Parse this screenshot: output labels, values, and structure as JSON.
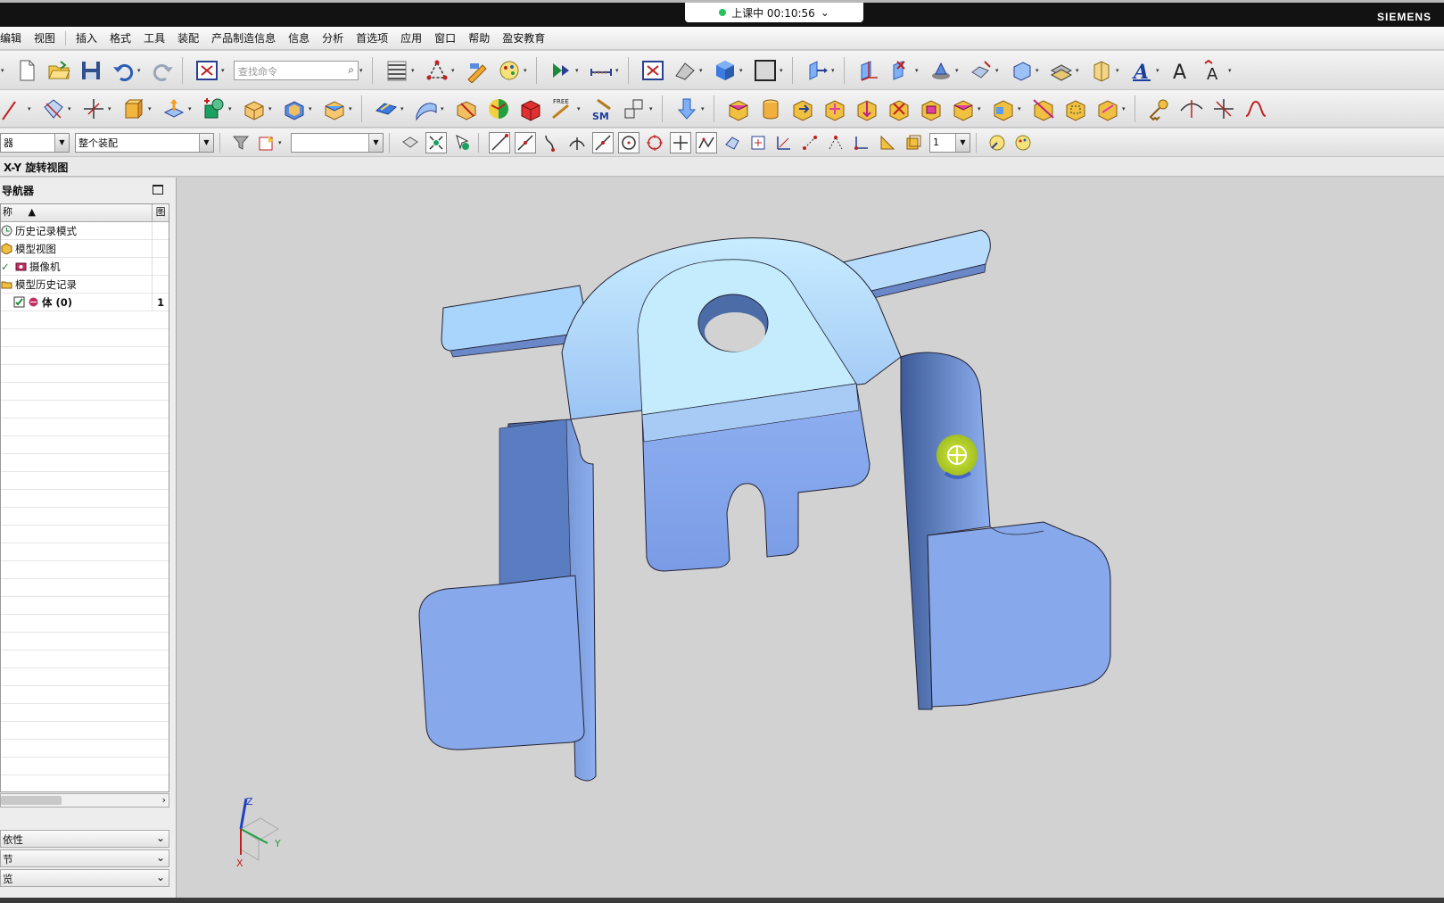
{
  "window": {
    "brand": "SIEMENS",
    "class_status": "上课中 00:10:56"
  },
  "menu": [
    "编辑",
    "视图",
    "插入",
    "格式",
    "工具",
    "装配",
    "产品制造信息",
    "信息",
    "分析",
    "首选项",
    "应用",
    "窗口",
    "帮助",
    "盈安教育"
  ],
  "toolbar1": {
    "search_placeholder": "查找命令"
  },
  "toolbar3": {
    "filter_combo": "器",
    "assembly_combo": "整个装配",
    "empty_combo": "",
    "layer_combo": "1"
  },
  "viewbar": {
    "title": "X-Y 旋转视图"
  },
  "navigator": {
    "title": "导航器",
    "col_name": "称",
    "col_flag": "图",
    "rows": [
      {
        "label": "历史记录模式",
        "flag": ""
      },
      {
        "label": "模型视图",
        "flag": ""
      },
      {
        "label": "摄像机",
        "flag": ""
      },
      {
        "label": "模型历史记录",
        "flag": ""
      },
      {
        "label": "体 (0)",
        "flag": "1"
      }
    ],
    "panels": [
      "依性",
      "节",
      "览"
    ]
  },
  "triad": {
    "z": "Z",
    "y": "Y",
    "x": "X"
  },
  "colors": {
    "part": "#8fb0f0",
    "part_light": "#b8e0fb",
    "background": "#d2d2d2"
  }
}
